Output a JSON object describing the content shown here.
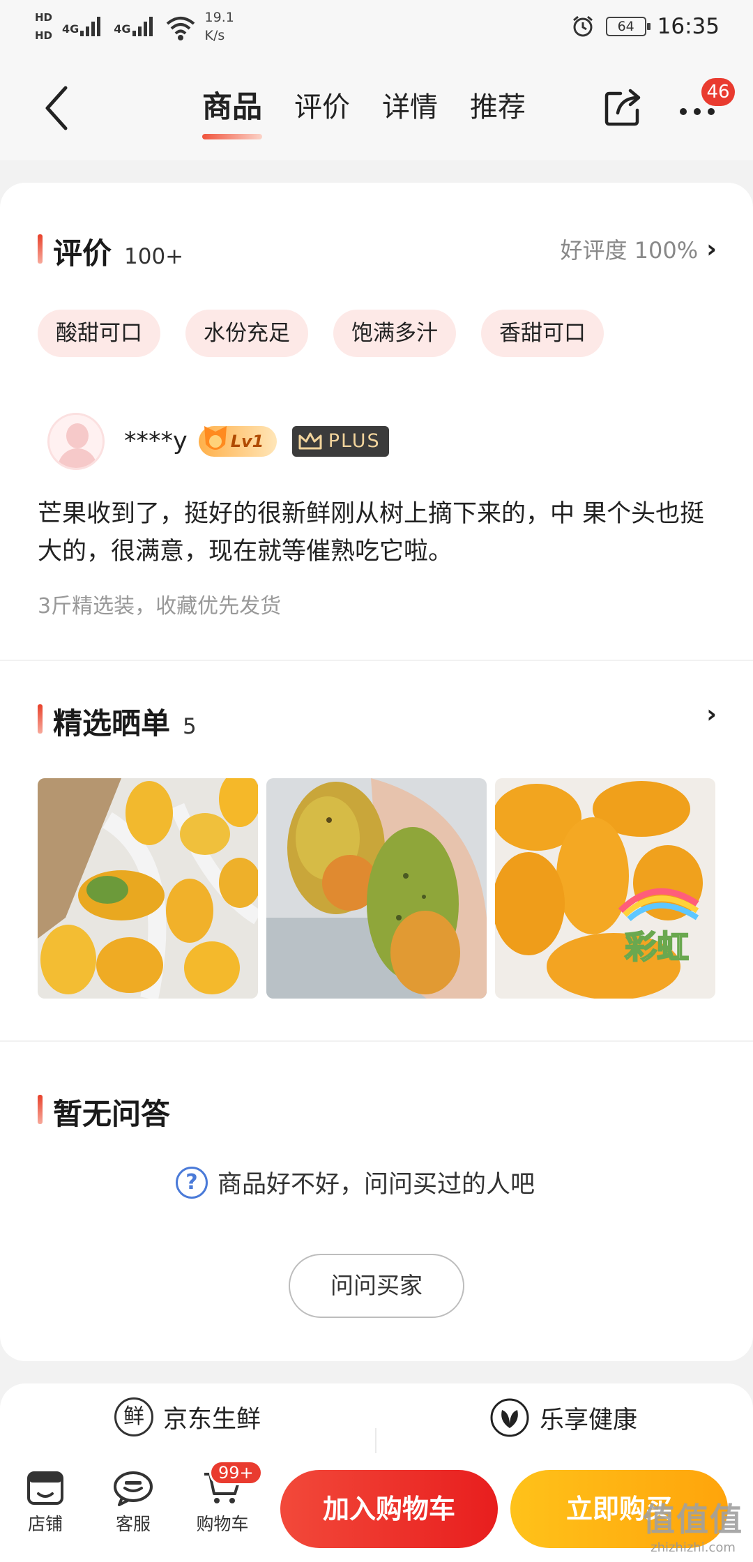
{
  "status_bar": {
    "hd1": "HD",
    "hd2": "HD",
    "sig1": "4G",
    "sig2": "4G",
    "speed": "19.1",
    "speed_unit": "K/s",
    "battery": "64",
    "time": "16:35"
  },
  "nav": {
    "tabs": [
      "商品",
      "评价",
      "详情",
      "推荐"
    ],
    "active_tab": "商品",
    "more_badge": "46"
  },
  "reviews": {
    "title": "评价",
    "count": "100+",
    "rating": "好评度 100%",
    "tags": [
      "酸甜可口",
      "水份充足",
      "饱满多汁",
      "香甜可口"
    ],
    "review": {
      "username": "****y",
      "level": "Lv1",
      "plus_label": "PLUS",
      "text": "芒果收到了，挺好的很新鲜刚从树上摘下来的，中 果个头也挺大的，很满意，现在就等催熟吃它啦。",
      "spec": "3斤精选装，收藏优先发货"
    }
  },
  "showcase": {
    "title": "精选晒单",
    "count": "5",
    "sticker_text": "彩虹"
  },
  "qa": {
    "title": "暂无问答",
    "hint": "商品好不好，问问买过的人吧",
    "button": "问问买家"
  },
  "brands": {
    "left_icon": "鲜",
    "left": "京东生鲜",
    "right": "乐享健康"
  },
  "bottom_bar": {
    "store": "店铺",
    "service": "客服",
    "cart": "购物车",
    "cart_badge": "99+",
    "add_to_cart": "加入购物车",
    "buy_now": "立即购买"
  },
  "watermark": {
    "main": "值值值",
    "sub": "zhizhizhi.com"
  },
  "colors": {
    "accent_red": "#e93b2f",
    "buy_orange": "#ffa40b",
    "tag_bg": "#fde9e7"
  }
}
